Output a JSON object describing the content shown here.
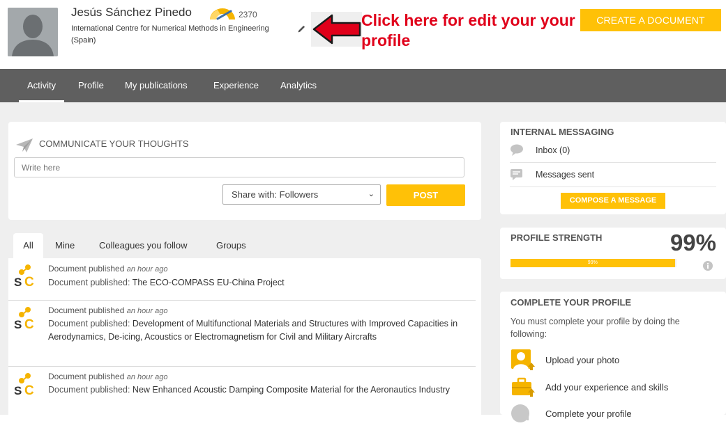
{
  "header": {
    "user_name": "Jesús Sánchez Pinedo",
    "score": "2370",
    "affiliation": "International Centre for Numerical Methods in Engineering",
    "country": "(Spain)",
    "annotation": "Click here for edit your your profile",
    "create_button": "CREATE A DOCUMENT"
  },
  "nav": {
    "tabs": [
      {
        "label": "Activity",
        "active": true
      },
      {
        "label": "Profile"
      },
      {
        "label": "My publications"
      },
      {
        "label": "Experience"
      },
      {
        "label": "Analytics"
      }
    ]
  },
  "communicate": {
    "title": "COMMUNICATE YOUR THOUGHTS",
    "placeholder": "Write here",
    "share_value": "Share with: Followers",
    "post_label": "POST"
  },
  "feed": {
    "tabs": [
      {
        "label": "All",
        "active": true
      },
      {
        "label": "Mine"
      },
      {
        "label": "Colleagues you follow"
      },
      {
        "label": "Groups"
      }
    ],
    "items": [
      {
        "type": "Document published",
        "time": "an hour ago",
        "label": "Document published:",
        "title": "The ECO-COMPASS EU-China Project"
      },
      {
        "type": "Document published",
        "time": "an hour ago",
        "label": "Document published:",
        "title": "Development of Multifunctional Materials and Structures with Improved Capacities in Aerodynamics, De-icing, Acoustics or Electromagnetism for Civil and Military Aircrafts"
      },
      {
        "type": "Document published",
        "time": "an hour ago",
        "label": "Document published:",
        "title": "New Enhanced Acoustic Damping Composite Material for the Aeronautics Industry"
      }
    ]
  },
  "messaging": {
    "title": "INTERNAL MESSAGING",
    "inbox": "Inbox (0)",
    "sent": "Messages sent",
    "compose": "COMPOSE A MESSAGE"
  },
  "strength": {
    "title": "PROFILE STRENGTH",
    "percent_label": "99%",
    "bar_label": "99%",
    "value": 0.99
  },
  "complete": {
    "title": "COMPLETE YOUR PROFILE",
    "description": "You must complete your profile by doing the following:",
    "tasks": [
      {
        "label": "Upload your photo",
        "icon": "upload-photo-icon"
      },
      {
        "label": "Add your experience and skills",
        "icon": "briefcase-icon"
      },
      {
        "label": "Complete your profile",
        "icon": "profile-ai-icon"
      }
    ]
  },
  "colors": {
    "accent": "#ffc107",
    "nav_bg": "#5f5f5f",
    "annotation": "#e0001a",
    "page_bg": "#efefef"
  }
}
